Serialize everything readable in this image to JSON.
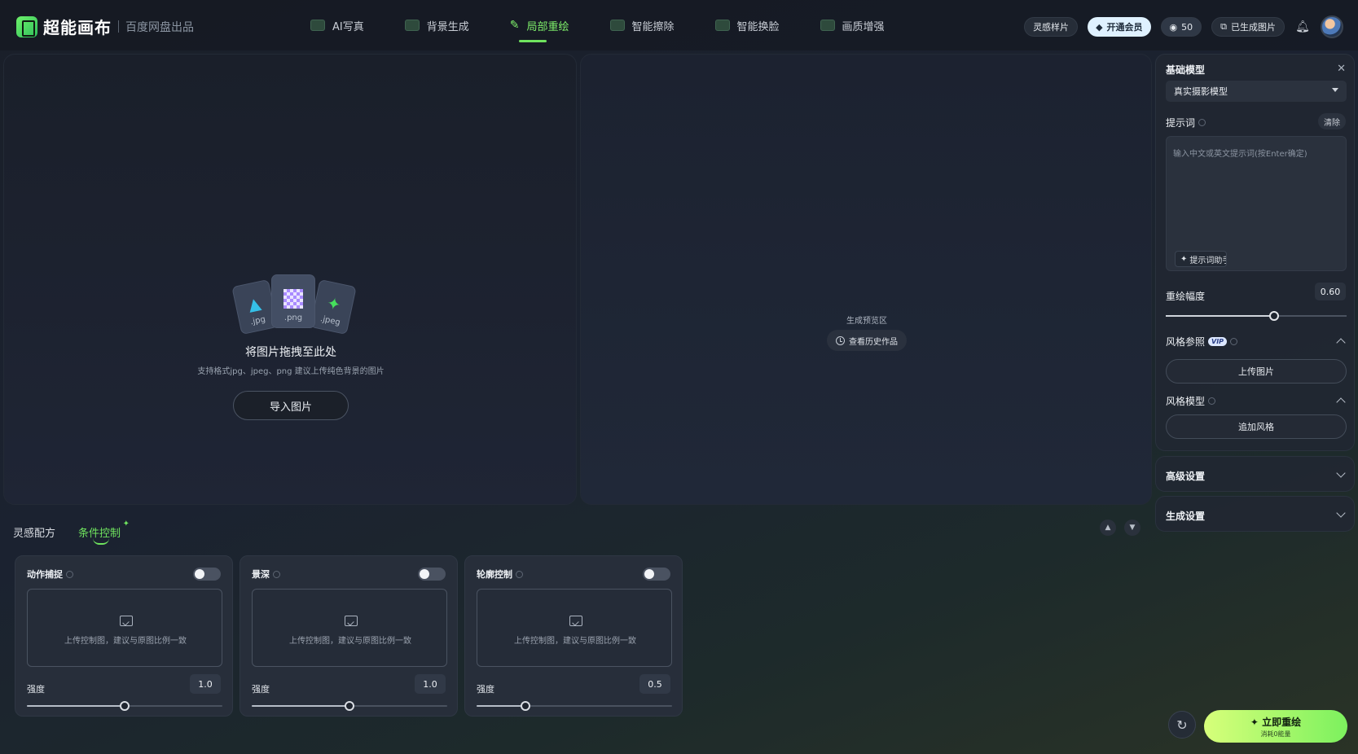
{
  "header": {
    "brand": "超能画布",
    "brand_sub": "百度网盘出品",
    "nav": [
      {
        "label": "AI写真"
      },
      {
        "label": "背景生成"
      },
      {
        "label": "局部重绘"
      },
      {
        "label": "智能擦除"
      },
      {
        "label": "智能换脸"
      },
      {
        "label": "画质增强"
      }
    ],
    "inspiration_label": "灵感样片",
    "vip_label": "开通会员",
    "energy_count": "50",
    "generated_label": "已生成图片"
  },
  "upload": {
    "file_types": [
      ".jpg",
      ".png",
      ".jpeg"
    ],
    "title": "将图片拖拽至此处",
    "hint": "支持格式jpg、jpeg、png 建议上传纯色背景的图片",
    "import_label": "导入图片"
  },
  "preview": {
    "label": "生成预览区",
    "history_label": "查看历史作品"
  },
  "bottom": {
    "tabs": [
      {
        "label": "灵感配方"
      },
      {
        "label": "条件控制"
      }
    ],
    "cards": [
      {
        "title": "动作捕捉",
        "drop_text": "上传控制图，建议与原图比例一致",
        "strength_label": "强度",
        "strength": 1.0,
        "strength_text": "1.0",
        "enabled": false
      },
      {
        "title": "景深",
        "drop_text": "上传控制图，建议与原图比例一致",
        "strength_label": "强度",
        "strength": 1.0,
        "strength_text": "1.0",
        "enabled": false
      },
      {
        "title": "轮廓控制",
        "drop_text": "上传控制图，建议与原图比例一致",
        "strength_label": "强度",
        "strength": 0.5,
        "strength_text": "0.5",
        "enabled": false
      }
    ],
    "strength_max": 2.0
  },
  "sidebar": {
    "base_model_label": "基础模型",
    "base_model_value": "真实摄影模型",
    "prompt_label": "提示词",
    "clear_label": "清除",
    "prompt_value": "",
    "prompt_placeholder": "输入中文或英文提示词(按Enter确定)",
    "assist_label": "提示词助手",
    "redraw_label": "重绘幅度",
    "redraw_value": "0.60",
    "redraw_fraction": 0.6,
    "style_ref_label": "风格参照",
    "vip_badge": "VIP",
    "upload_image_label": "上传图片",
    "style_model_label": "风格模型",
    "add_style_label": "追加风格",
    "advanced_label": "高级设置",
    "generate_settings_label": "生成设置"
  },
  "actions": {
    "generate_label": "立即重绘",
    "generate_sub": "消耗0能量"
  },
  "icons": {
    "brand": "logo-icon",
    "bell": "bell-icon",
    "refresh": "refresh-icon",
    "close": "close-icon"
  },
  "colors": {
    "accent": "#6fe35e",
    "background": "#1b2230",
    "vip_pill": "#dff1ff"
  }
}
